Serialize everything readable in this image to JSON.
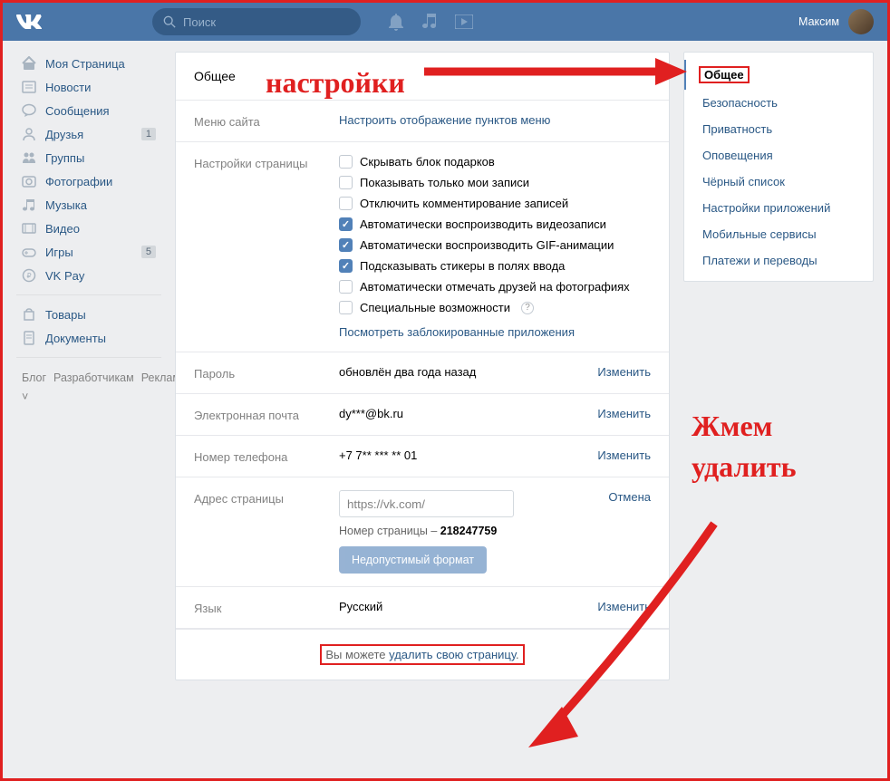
{
  "header": {
    "search_placeholder": "Поиск",
    "user_name": "Максим"
  },
  "left_nav": {
    "items": [
      {
        "label": "Моя Страница",
        "icon": "home"
      },
      {
        "label": "Новости",
        "icon": "news"
      },
      {
        "label": "Сообщения",
        "icon": "msg"
      },
      {
        "label": "Друзья",
        "icon": "friends",
        "badge": "1"
      },
      {
        "label": "Группы",
        "icon": "groups"
      },
      {
        "label": "Фотографии",
        "icon": "photo"
      },
      {
        "label": "Музыка",
        "icon": "music"
      },
      {
        "label": "Видео",
        "icon": "video"
      },
      {
        "label": "Игры",
        "icon": "games",
        "badge": "5"
      },
      {
        "label": "VK Pay",
        "icon": "pay"
      }
    ],
    "items2": [
      {
        "label": "Товары",
        "icon": "market"
      },
      {
        "label": "Документы",
        "icon": "docs"
      }
    ],
    "footer": [
      "Блог",
      "Разработчикам",
      "Реклама",
      "Ещё ˅"
    ]
  },
  "main": {
    "title": "Общее",
    "menu": {
      "label": "Меню сайта",
      "link": "Настроить отображение пунктов меню"
    },
    "page_settings": {
      "label": "Настройки страницы",
      "checkboxes": [
        {
          "label": "Скрывать блок подарков",
          "checked": false
        },
        {
          "label": "Показывать только мои записи",
          "checked": false
        },
        {
          "label": "Отключить комментирование записей",
          "checked": false
        },
        {
          "label": "Автоматически воспроизводить видеозаписи",
          "checked": true
        },
        {
          "label": "Автоматически воспроизводить GIF-анимации",
          "checked": true
        },
        {
          "label": "Подсказывать стикеры в полях ввода",
          "checked": true
        },
        {
          "label": "Автоматически отмечать друзей на фотографиях",
          "checked": false
        },
        {
          "label": "Специальные возможности",
          "checked": false,
          "help": true
        }
      ],
      "blocked_link": "Посмотреть заблокированные приложения"
    },
    "password": {
      "label": "Пароль",
      "value": "обновлён два года назад",
      "action": "Изменить"
    },
    "email": {
      "label": "Электронная почта",
      "value": "dy***@bk.ru",
      "action": "Изменить"
    },
    "phone": {
      "label": "Номер телефона",
      "value": "+7 7** *** ** 01",
      "action": "Изменить"
    },
    "address": {
      "label": "Адрес страницы",
      "url_prefix": "https://vk.com/",
      "num_label": "Номер страницы – ",
      "num": "218247759",
      "btn": "Недопустимый формат",
      "action": "Отмена"
    },
    "lang": {
      "label": "Язык",
      "value": "Русский",
      "action": "Изменить"
    },
    "delete": {
      "prefix": "Вы можете ",
      "link": "удалить свою страницу",
      "suffix": "."
    }
  },
  "right_nav": {
    "items": [
      "Общее",
      "Безопасность",
      "Приватность",
      "Оповещения",
      "Чёрный список",
      "Настройки приложений",
      "Мобильные сервисы",
      "Платежи и переводы"
    ]
  },
  "annotations": {
    "a1": "настройки",
    "a2": "Жмем удалить"
  }
}
